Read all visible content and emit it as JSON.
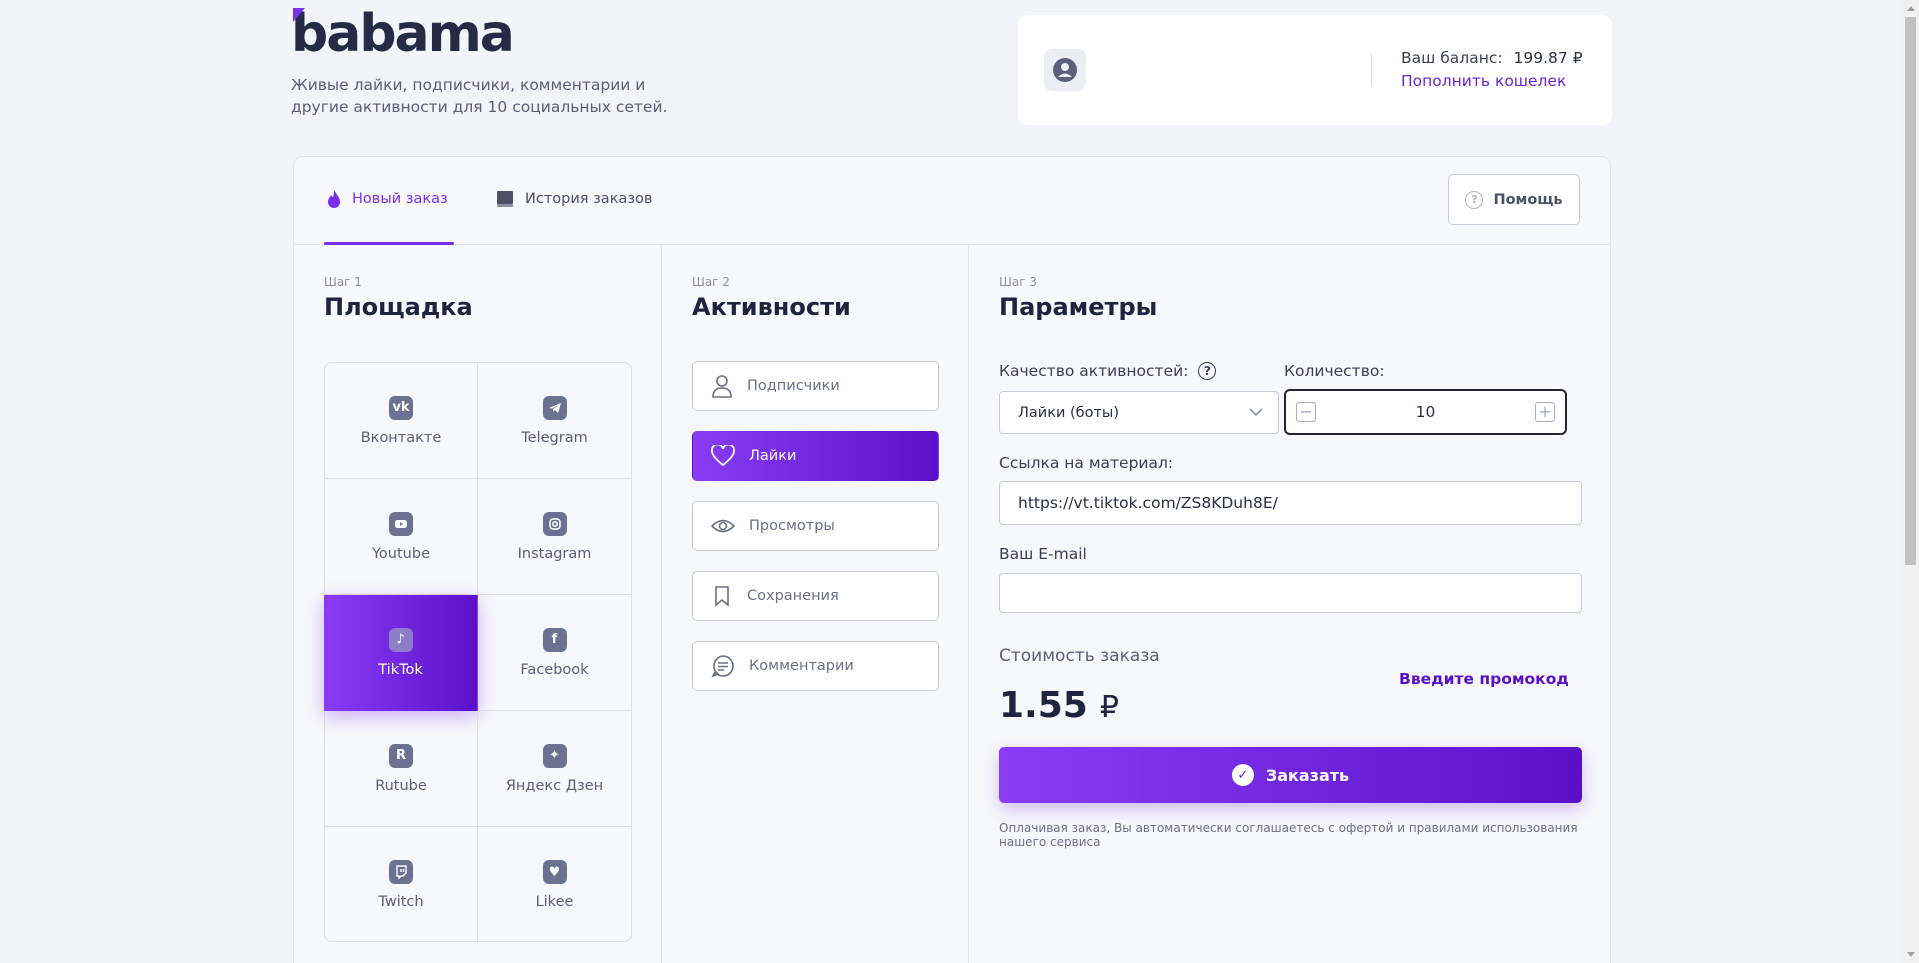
{
  "brand": {
    "logo_text": "babama",
    "tagline_line1": "Живые лайки, подписчики, комментарии и",
    "tagline_line2": "другие активности для 10 социальных сетей."
  },
  "account": {
    "balance_label": "Ваш баланс:",
    "balance_value": "199.87 ₽",
    "topup_link": "Пополнить кошелек"
  },
  "tabs": [
    {
      "label": "Новый заказ",
      "icon": "flame-icon",
      "active": true
    },
    {
      "label": "История заказов",
      "icon": "book-icon",
      "active": false
    }
  ],
  "help_button": "Помощь",
  "step1": {
    "label": "Шаг 1",
    "title": "Площадка",
    "platforms": [
      {
        "name": "Вконтакте",
        "icon": "vk-icon"
      },
      {
        "name": "Telegram",
        "icon": "telegram-icon"
      },
      {
        "name": "Youtube",
        "icon": "youtube-icon"
      },
      {
        "name": "Instagram",
        "icon": "instagram-icon"
      },
      {
        "name": "TikTok",
        "icon": "tiktok-icon",
        "active": true
      },
      {
        "name": "Facebook",
        "icon": "facebook-icon"
      },
      {
        "name": "Rutube",
        "icon": "rutube-icon"
      },
      {
        "name": "Яндекс Дзен",
        "icon": "zen-icon"
      },
      {
        "name": "Twitch",
        "icon": "twitch-icon"
      },
      {
        "name": "Likee",
        "icon": "likee-icon"
      }
    ]
  },
  "step2": {
    "label": "Шаг 2",
    "title": "Активности",
    "activities": [
      {
        "name": "Подписчики",
        "icon": "user-icon"
      },
      {
        "name": "Лайки",
        "icon": "heart-icon",
        "active": true
      },
      {
        "name": "Просмотры",
        "icon": "eye-icon"
      },
      {
        "name": "Сохранения",
        "icon": "bookmark-icon"
      },
      {
        "name": "Комментарии",
        "icon": "comment-icon"
      }
    ]
  },
  "step3": {
    "label": "Шаг 3",
    "title": "Параметры",
    "quality_label": "Качество активностей:",
    "quality_value": "Лайки (боты)",
    "quantity_label": "Количество:",
    "quantity_value": "10",
    "link_label": "Ссылка на материал:",
    "link_value": "https://vt.tiktok.com/ZS8KDuh8E/",
    "email_label": "Ваш E-mail",
    "email_value": "",
    "cost_label": "Стоимость заказа",
    "cost_value": "1.55",
    "cost_currency": "₽",
    "promo_link": "Введите промокод",
    "order_button": "Заказать",
    "terms": "Оплачивая заказ, Вы автоматически соглашаетесь с офертой и правилами использования нашего сервиса"
  },
  "colors": {
    "accent": "#7a2ff0",
    "accent_dark": "#5a10c9",
    "text_dark": "#1f2340",
    "background": "#f3f4f9"
  }
}
